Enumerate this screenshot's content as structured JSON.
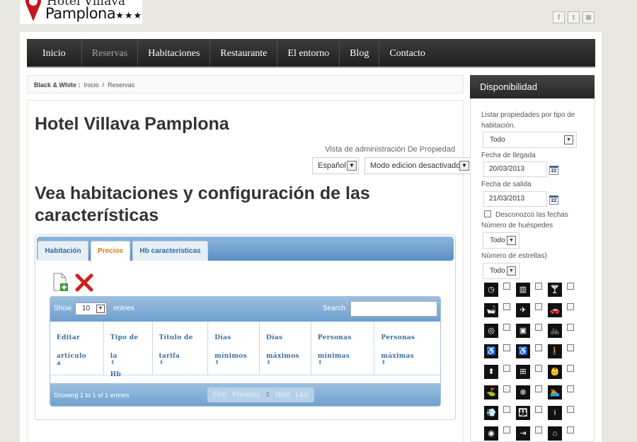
{
  "logo": {
    "line1": "Hotel Villava",
    "line2": "Pamplona",
    "stars": "★★★"
  },
  "social": [
    {
      "name": "facebook-icon",
      "glyph": "f"
    },
    {
      "name": "twitter-icon",
      "glyph": "t"
    },
    {
      "name": "lock-icon",
      "glyph": "🔒"
    }
  ],
  "nav": {
    "items": [
      "Inicio",
      "Reservas",
      "Habitaciones",
      "Restaurante",
      "El entorno",
      "Blog",
      "Contacto"
    ],
    "active": "Reservas"
  },
  "breadcrumb": {
    "prefix": "Black & White :",
    "home": "Inicio",
    "sep": "/",
    "current": "Reservas"
  },
  "main": {
    "title": "Hotel Villava Pamplona",
    "admin_view": "Vista de administración De Propiedad",
    "language": "Español",
    "edit_mode": "Modo edicion desactivado",
    "subtitle": "Vea habitaciones y configuración de las características"
  },
  "tabs": [
    {
      "label": "Habitación",
      "active": false
    },
    {
      "label": "Precios",
      "active": true
    },
    {
      "label": "Hb caracteristicas",
      "active": false
    }
  ],
  "table": {
    "show_label": "Show",
    "length": "10",
    "entries_label": "entries",
    "search_label": "Search:",
    "columns": [
      {
        "l1": "Editar",
        "l2": "artículo",
        "sort": "▲"
      },
      {
        "l1": "Tipo de la",
        "l2": "Hb",
        "sort": "⬍"
      },
      {
        "l1": "Título de",
        "l2": "tarifa",
        "sort": "⬍"
      },
      {
        "l1": "Días",
        "l2": "mínimos",
        "sort": "⬍"
      },
      {
        "l1": "Días",
        "l2": "máximos",
        "sort": "⬍"
      },
      {
        "l1": "Personas",
        "l2": "mínimas",
        "sort": "⬍"
      },
      {
        "l1": "Personas",
        "l2": "máximas",
        "sort": "⬍"
      }
    ],
    "info": "Showing 1 to 1 of 1 entries",
    "pager": {
      "first": "First",
      "previous": "Previous",
      "current": "1",
      "next": "Next",
      "last": "Last"
    }
  },
  "sidebar": {
    "title": "Disponibilidad",
    "type_label": "Listar propiedades por tipo de habitación.",
    "type_value": "Todo",
    "arrival_label": "Fecha de llegada",
    "arrival_value": "20/03/2013",
    "departure_label": "Fecha de salida",
    "departure_value": "21/03/2013",
    "calendar_glyph": "22",
    "unknown_dates_label": "Desconozco las fechas",
    "guests_label": "Número de huéspedes",
    "guests_value": "Todo",
    "stars_label": "Número de estrellas)",
    "stars_value": "Todo",
    "amenities": [
      {
        "name": "clock-icon",
        "glyph": "◷"
      },
      {
        "name": "elevator-icon",
        "glyph": "▥"
      },
      {
        "name": "bar-icon",
        "glyph": "🍸"
      },
      {
        "name": "bathtub-icon",
        "glyph": "🛁"
      },
      {
        "name": "plane-icon",
        "glyph": "✈"
      },
      {
        "name": "car-icon",
        "glyph": "🚗"
      },
      {
        "name": "cd-icon",
        "glyph": "◎"
      },
      {
        "name": "tv-icon",
        "glyph": "▣"
      },
      {
        "name": "bicycle-icon",
        "glyph": "🚲"
      },
      {
        "name": "wheelchair-icon",
        "glyph": "♿"
      },
      {
        "name": "wheelchair-access-icon",
        "glyph": "♿"
      },
      {
        "name": "walk-icon",
        "glyph": "🚶"
      },
      {
        "name": "elevator-arrows-icon",
        "glyph": "⬍"
      },
      {
        "name": "frame-icon",
        "glyph": "⊞"
      },
      {
        "name": "stroller-icon",
        "glyph": "👶"
      },
      {
        "name": "golf-icon",
        "glyph": "⛳"
      },
      {
        "name": "no-entry-icon",
        "glyph": "⊗"
      },
      {
        "name": "swim-icon",
        "glyph": "🏊"
      },
      {
        "name": "hairdryer-icon",
        "glyph": "💨"
      },
      {
        "name": "family-icon",
        "glyph": "👪"
      },
      {
        "name": "info-icon",
        "glyph": "i"
      },
      {
        "name": "spiral-icon",
        "glyph": "◉"
      },
      {
        "name": "exit-icon",
        "glyph": "⇥"
      },
      {
        "name": "home-icon",
        "glyph": "⌂"
      }
    ]
  }
}
